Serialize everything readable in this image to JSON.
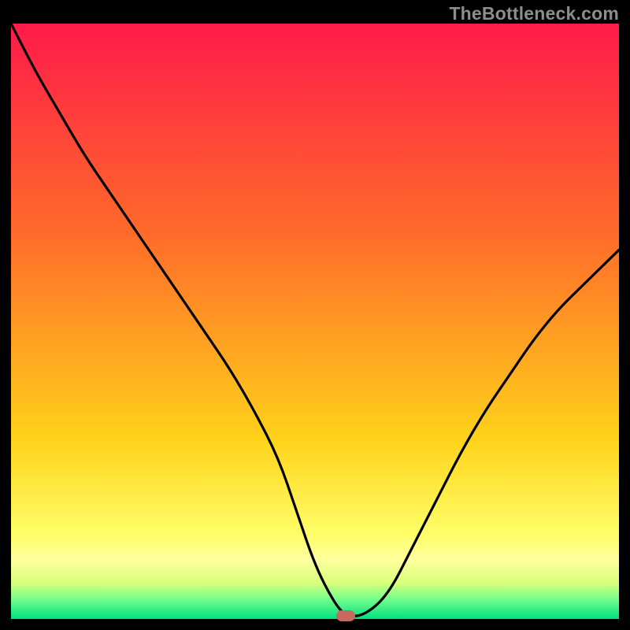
{
  "watermark": "TheBottleneck.com",
  "colors": {
    "bg_black": "#000000",
    "gradient_top": "#ff1a4a",
    "gradient_mid1": "#ff6a2a",
    "gradient_mid2": "#ffd31a",
    "gradient_band": "#ffff9e",
    "gradient_green": "#00e080",
    "curve": "#000000",
    "marker": "#c66a5f"
  },
  "chart_data": {
    "type": "line",
    "title": "",
    "xlabel": "",
    "ylabel": "",
    "xlim": [
      0,
      100
    ],
    "ylim": [
      0,
      100
    ],
    "x": [
      0,
      4,
      8,
      12,
      16,
      20,
      24,
      28,
      32,
      36,
      40,
      44,
      47,
      50,
      53,
      55,
      58,
      62,
      66,
      70,
      74,
      78,
      82,
      86,
      90,
      94,
      98,
      100
    ],
    "values": [
      100,
      92,
      85,
      78,
      72,
      66,
      60,
      54,
      48,
      42,
      35,
      27,
      18,
      9,
      3,
      0.5,
      0.5,
      4,
      12,
      20,
      28,
      35,
      41,
      47,
      52,
      56,
      60,
      62
    ],
    "marker": {
      "x": 55,
      "y": 0.5
    },
    "background_gradient_stops": [
      {
        "pos": 0.0,
        "color": "#ff1a4a"
      },
      {
        "pos": 0.35,
        "color": "#ff6a2a"
      },
      {
        "pos": 0.7,
        "color": "#ffd31a"
      },
      {
        "pos": 0.86,
        "color": "#ffff6a"
      },
      {
        "pos": 0.9,
        "color": "#ffff9e"
      },
      {
        "pos": 0.94,
        "color": "#d8ff7a"
      },
      {
        "pos": 0.965,
        "color": "#7aff8c"
      },
      {
        "pos": 1.0,
        "color": "#00e080"
      }
    ]
  }
}
